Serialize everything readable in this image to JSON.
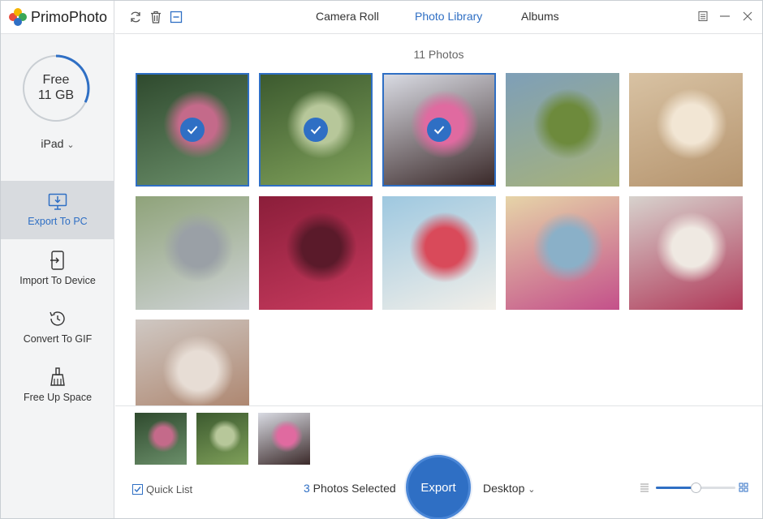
{
  "app": {
    "name": "PrimoPhoto",
    "accent": "#2f6fc4"
  },
  "storage": {
    "label_line1": "Free",
    "label_line2": "11 GB",
    "used_fraction": 0.32
  },
  "device": {
    "name": "iPad",
    "caret": "⌄"
  },
  "sidebar": {
    "items": [
      {
        "label": "Export To PC",
        "icon": "monitor-download-icon",
        "active": true
      },
      {
        "label": "Import To Device",
        "icon": "device-import-icon",
        "active": false
      },
      {
        "label": "Convert To GIF",
        "icon": "history-clock-icon",
        "active": false
      },
      {
        "label": "Free Up Space",
        "icon": "broom-icon",
        "active": false
      }
    ]
  },
  "toolbar": {
    "icons": [
      "refresh-icon",
      "trash-icon",
      "deselect-icon"
    ]
  },
  "tabs": [
    {
      "label": "Camera Roll",
      "active": false
    },
    {
      "label": "Photo Library",
      "active": true
    },
    {
      "label": "Albums",
      "active": false
    }
  ],
  "window_controls": [
    "menu-icon",
    "minimize-icon",
    "close-icon"
  ],
  "photo_count": "11 Photos",
  "photos": [
    {
      "selected": true,
      "colors": [
        "#2f4a2e",
        "#6b8f6a",
        "#c46a8a"
      ]
    },
    {
      "selected": true,
      "colors": [
        "#3c5a2f",
        "#7fa05a",
        "#b7c79a"
      ]
    },
    {
      "selected": true,
      "colors": [
        "#d9dbe3",
        "#3b2a2a",
        "#e06aa0"
      ]
    },
    {
      "selected": false,
      "colors": [
        "#7e9fb8",
        "#a7b27a",
        "#6d8a3c"
      ]
    },
    {
      "selected": false,
      "colors": [
        "#d8c2a3",
        "#b5946e",
        "#f2e6d4"
      ]
    },
    {
      "selected": false,
      "colors": [
        "#8fa37a",
        "#cfd3d6",
        "#9aa0a6"
      ]
    },
    {
      "selected": false,
      "colors": [
        "#8b1e3a",
        "#c73a5e",
        "#5a1a2a"
      ]
    },
    {
      "selected": false,
      "colors": [
        "#9ec8e0",
        "#f2efe9",
        "#d94a5a"
      ]
    },
    {
      "selected": false,
      "colors": [
        "#e6d4a8",
        "#c4508a",
        "#8ab0c8"
      ]
    },
    {
      "selected": false,
      "colors": [
        "#d7d2cd",
        "#b03a5a",
        "#efe9e2"
      ]
    },
    {
      "selected": false,
      "colors": [
        "#cfc8c3",
        "#a7795f",
        "#e7ddd5"
      ]
    }
  ],
  "quick_list": {
    "label": "Quick List",
    "checked": true
  },
  "selection": {
    "count": "3",
    "suffix": " Photos Selected"
  },
  "export": {
    "label": "Export",
    "destination": "Desktop",
    "caret": "⌄"
  },
  "zoom": {
    "level": 0.5
  }
}
